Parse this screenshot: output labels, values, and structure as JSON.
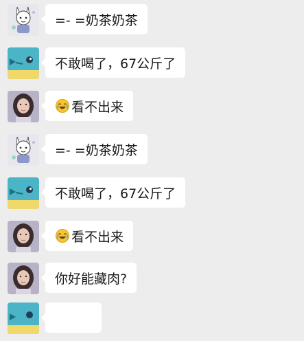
{
  "messages": [
    {
      "sender": "cartoon-boy",
      "text": "=- =奶茶奶茶",
      "emoji": null
    },
    {
      "sender": "fish",
      "text": "不敢喝了，67公斤了",
      "emoji": null
    },
    {
      "sender": "girl",
      "text": "看不出来",
      "emoji": "laughing-crying-emoji-icon"
    },
    {
      "sender": "cartoon-boy",
      "text": "=- =奶茶奶茶",
      "emoji": null
    },
    {
      "sender": "fish",
      "text": "不敢喝了，67公斤了",
      "emoji": null
    },
    {
      "sender": "girl",
      "text": "看不出来",
      "emoji": "laughing-crying-emoji-icon"
    },
    {
      "sender": "girl",
      "text": "你好能藏肉?",
      "emoji": null
    },
    {
      "sender": "fish",
      "text": "",
      "emoji": null
    }
  ],
  "colors": {
    "background": "#ededed",
    "bubble": "#ffffff",
    "text": "#1a1a1a",
    "fish_body": "#4bb4c6",
    "fish_band": "#f0d96a"
  }
}
